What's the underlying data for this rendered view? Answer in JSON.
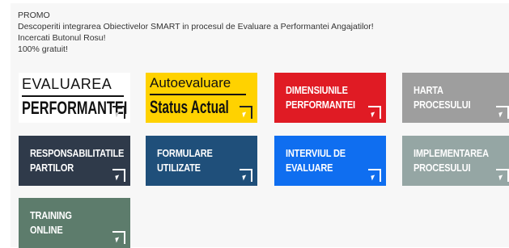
{
  "promo": {
    "lines": [
      "PROMO",
      "Descoperiti integrarea Obiectivelor SMART in procesul de Evaluare a Performantei Angajatilor!",
      "Incercati Butonul Rosu!",
      "100% gratuit!"
    ]
  },
  "tiles": {
    "evaluarea": {
      "line1": "EVALUAREA",
      "line2": "PERFORMANTEI",
      "color": "#ffffff"
    },
    "autoevaluare": {
      "line1": "Autoevaluare",
      "line2": "Status Actual",
      "color": "#ffd200"
    },
    "dimensiunile": {
      "line1": "DIMENSIUNILE",
      "line2": "PERFORMANTEI",
      "color": "#e01b24"
    },
    "harta": {
      "line1": "HARTA",
      "line2": "PROCESULUI",
      "color": "#9e9e9e"
    },
    "responsabilitatile": {
      "line1": "RESPONSABILITATILE",
      "line2": "PARTILOR",
      "color": "#2f3a4a"
    },
    "formulare": {
      "line1": "FORMULARE",
      "line2": "UTILIZATE",
      "color": "#1f4f7a"
    },
    "interviul": {
      "line1": "INTERVIUL DE",
      "line2": "EVALUARE",
      "color": "#0f6ef0"
    },
    "implementarea": {
      "line1": "IMPLEMENTAREA",
      "line2": "PROCESULUI",
      "color": "#95a6a4"
    },
    "training": {
      "line1": "TRAINING",
      "line2": "ONLINE",
      "color": "#5d7c6c"
    }
  }
}
